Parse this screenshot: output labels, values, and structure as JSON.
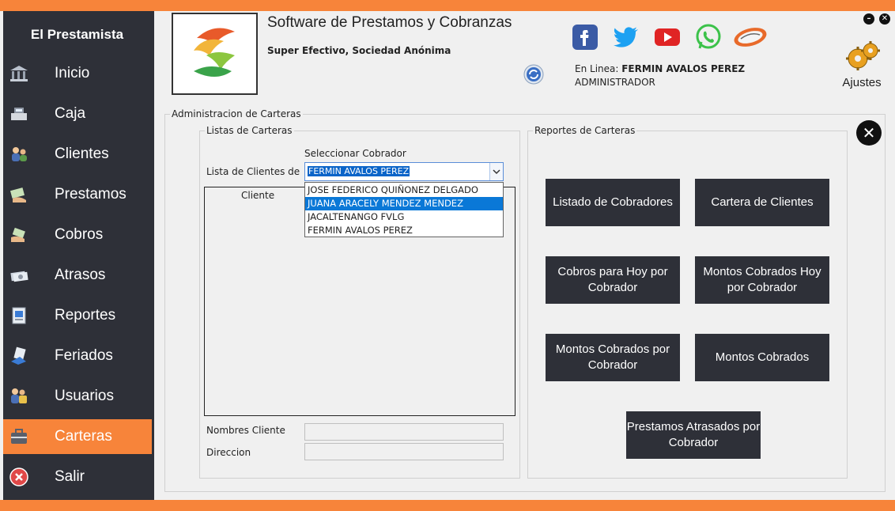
{
  "app": {
    "sidebar_title": "El Prestamista",
    "name": "Software de Prestamos y Cobranzas",
    "company": "Super Efectivo, Sociedad Anónima"
  },
  "user": {
    "online_prefix": "En Linea:",
    "name": "FERMIN AVALOS PEREZ",
    "role": "ADMINISTRADOR"
  },
  "settings_label": "Ajustes",
  "nav": [
    {
      "label": "Inicio",
      "icon": "bank-icon"
    },
    {
      "label": "Caja",
      "icon": "cash-register-icon"
    },
    {
      "label": "Clientes",
      "icon": "clients-icon"
    },
    {
      "label": "Prestamos",
      "icon": "loan-icon"
    },
    {
      "label": "Cobros",
      "icon": "payment-icon"
    },
    {
      "label": "Atrasos",
      "icon": "overdue-icon"
    },
    {
      "label": "Reportes",
      "icon": "reports-icon"
    },
    {
      "label": "Feriados",
      "icon": "holidays-icon"
    },
    {
      "label": "Usuarios",
      "icon": "users-icon"
    },
    {
      "label": "Carteras",
      "icon": "portfolio-icon",
      "active": true
    },
    {
      "label": "Salir",
      "icon": "exit-icon"
    }
  ],
  "main": {
    "section_title": "Administracion de Carteras",
    "lists_group": "Listas de Carteras",
    "select_collector_label": "Seleccionar Cobrador",
    "client_list_label": "Lista de Clientes de",
    "selected_collector": "FERMIN AVALOS PEREZ",
    "collector_options": [
      "JOSE FEDERICO QUIÑONEZ DELGADO",
      "JUANA  ARACELY MENDEZ MENDEZ",
      "JACALTENANGO FVLG",
      "FERMIN AVALOS PEREZ"
    ],
    "highlighted_option_index": 1,
    "grid_column": "Cliente",
    "names_label": "Nombres Cliente",
    "address_label": "Direccion"
  },
  "reports": {
    "group_title": "Reportes de Carteras",
    "buttons": [
      "Listado de Cobradores",
      "Cartera de Clientes",
      "Cobros para Hoy por Cobrador",
      "Montos Cobrados Hoy por Cobrador",
      "Montos Cobrados por Cobrador",
      "Montos Cobrados",
      "Prestamos Atrasados por Cobrador"
    ]
  },
  "colors": {
    "accent": "#f7843a",
    "sidebar": "#2e3038",
    "button": "#2e3038"
  }
}
